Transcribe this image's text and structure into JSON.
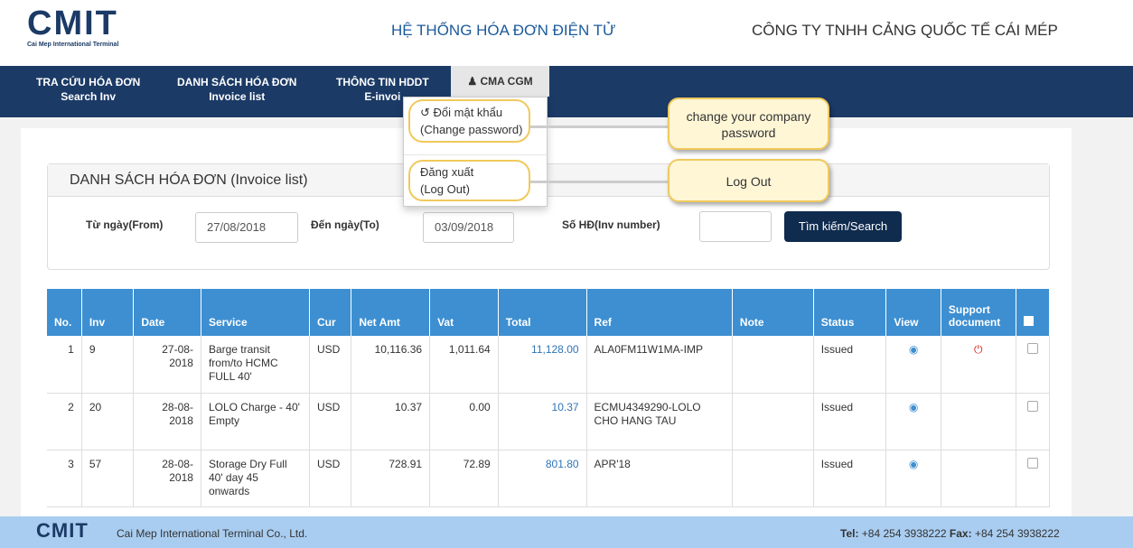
{
  "header": {
    "logo_text": "CMIT",
    "logo_subtitle": "Cai Mep International Terminal",
    "system_title": "HỆ THỐNG HÓA ĐƠN ĐIỆN TỬ",
    "company_name": "CÔNG TY TNHH CẢNG QUỐC TẾ CÁI MÉP"
  },
  "nav": {
    "items": [
      {
        "label_vi": "TRA CỨU HÓA ĐƠN",
        "label_en": "Search Inv"
      },
      {
        "label_vi": "DANH SÁCH HÓA ĐƠN",
        "label_en": "Invoice list"
      },
      {
        "label_vi": "THÔNG TIN HDDT",
        "label_en": "E-invoi"
      }
    ],
    "user": "CMA CGM",
    "user_icon": "user-icon"
  },
  "dropdown": {
    "change_password_vi": "Đổi mật khẩu",
    "change_password_en": "(Change password)",
    "logout_vi": "Đăng xuất",
    "logout_en": "(Log Out)"
  },
  "callouts": {
    "change_password": "change your company password",
    "logout": "Log Out"
  },
  "invoice_list": {
    "title": "DANH SÁCH HÓA ĐƠN (Invoice list)",
    "from_label": "Từ ngày(From)",
    "from_value": "27/08/2018",
    "to_label": "Đến ngày(To)",
    "to_value": "03/09/2018",
    "inv_label": "Số HĐ(Inv number)",
    "inv_value": "",
    "search_button": "Tìm kiếm/Search"
  },
  "table": {
    "headers": [
      "No.",
      "Inv",
      "Date",
      "Service",
      "Cur",
      "Net Amt",
      "Vat",
      "Total",
      "Ref",
      "Note",
      "Status",
      "View",
      "Support document",
      ""
    ],
    "rows": [
      {
        "no": "1",
        "inv": "9",
        "date": "27-08-2018",
        "service": "Barge transit from/to HCMC FULL 40'",
        "cur": "USD",
        "net": "10,116.36",
        "vat": "1,011.64",
        "total": "11,128.00",
        "ref": "ALA0FM11W1MA-IMP",
        "note": "",
        "status": "Issued",
        "support": true
      },
      {
        "no": "2",
        "inv": "20",
        "date": "28-08-2018",
        "service": "LOLO Charge - 40' Empty",
        "cur": "USD",
        "net": "10.37",
        "vat": "0.00",
        "total": "10.37",
        "ref": "ECMU4349290-LOLO CHO HANG TAU",
        "note": "",
        "status": "Issued",
        "support": false
      },
      {
        "no": "3",
        "inv": "57",
        "date": "28-08-2018",
        "service": "Storage Dry Full 40' day 45 onwards",
        "cur": "USD",
        "net": "728.91",
        "vat": "72.89",
        "total": "801.80",
        "ref": "APR'18",
        "note": "",
        "status": "Issued",
        "support": false
      }
    ]
  },
  "footer": {
    "logo_text": "CMIT",
    "company": "Cai Mep International Terminal Co., Ltd.",
    "tel_label": "Tel:",
    "tel_value": "+84 254 3938222",
    "fax_label": "Fax:",
    "fax_value": "+84 254 3938222"
  },
  "colors": {
    "nav_bg": "#1b3a66",
    "table_header": "#3d8fd1",
    "footer_bg": "#a9cdf0",
    "callout_border": "#f0c95c"
  }
}
